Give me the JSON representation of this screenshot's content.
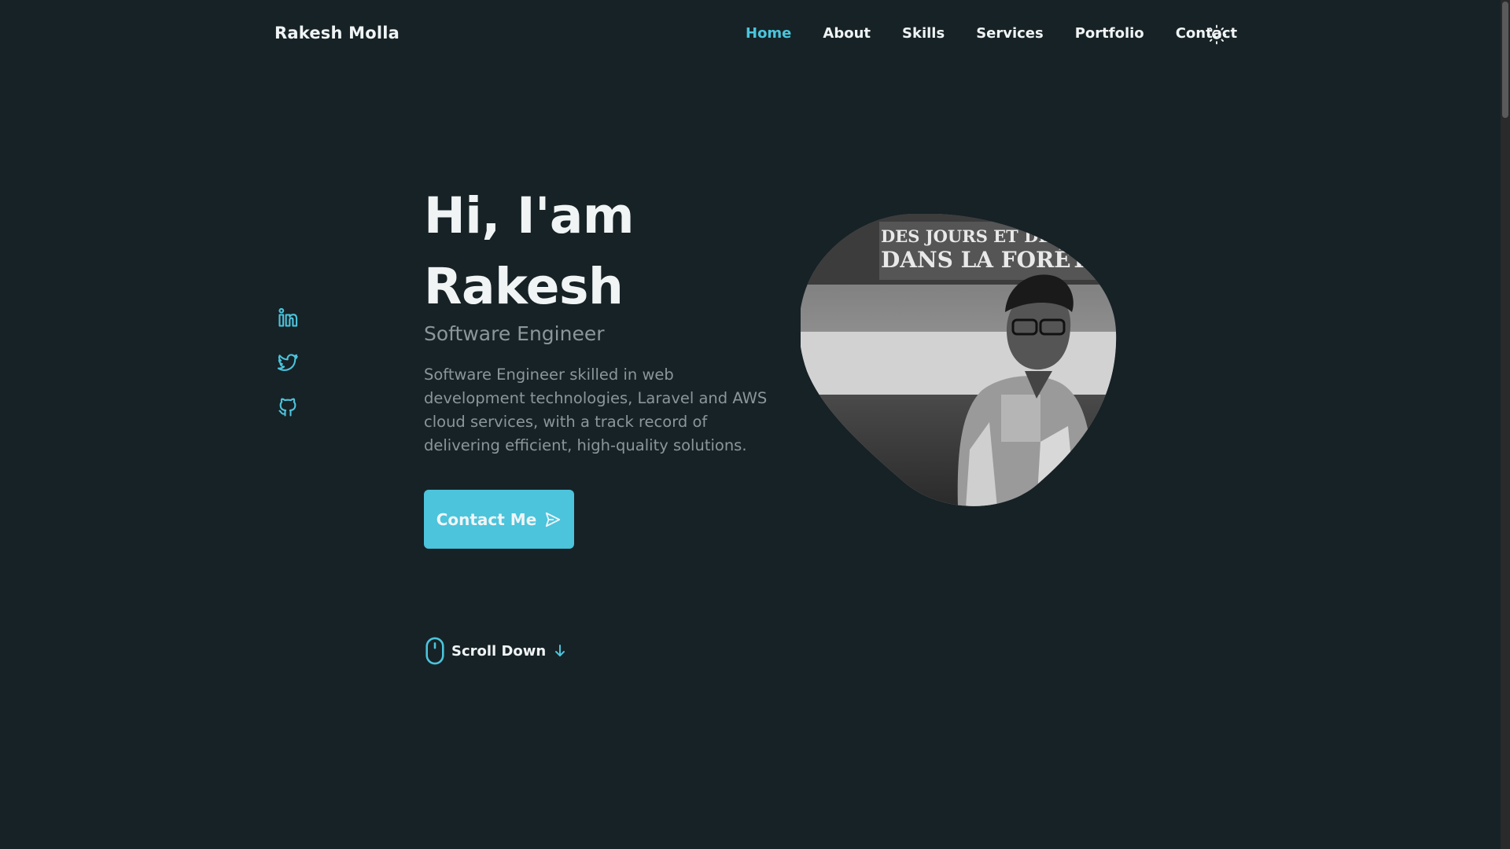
{
  "brand": "Rakesh Molla",
  "nav": {
    "items": [
      {
        "label": "Home",
        "active": true
      },
      {
        "label": "About",
        "active": false
      },
      {
        "label": "Skills",
        "active": false
      },
      {
        "label": "Services",
        "active": false
      },
      {
        "label": "Portfolio",
        "active": false
      },
      {
        "label": "Contact",
        "active": false
      }
    ],
    "theme_toggle_icon": "sun-icon"
  },
  "social": {
    "icons": [
      "linkedin-icon",
      "twitter-icon",
      "github-icon"
    ]
  },
  "hero": {
    "title_line1": "Hi, I'am",
    "title_line2": "Rakesh",
    "subtitle": "Software Engineer",
    "description": "Software Engineer skilled in web development technologies, Laravel and AWS cloud services, with a track record of delivering efficient, high-quality solutions.",
    "contact_button": "Contact Me",
    "contact_icon": "send-icon",
    "scroll_down": "Scroll Down",
    "scroll_icons": [
      "mouse-icon",
      "arrow-down-icon"
    ]
  },
  "profile_image_text": {
    "line1": "DES JOURS ET DES NUITS",
    "line2": "DANS LA FORÊT"
  },
  "colors": {
    "background": "#172226",
    "accent": "#4bc4dc",
    "text": "#f0f4f5",
    "muted": "#8a969a"
  }
}
